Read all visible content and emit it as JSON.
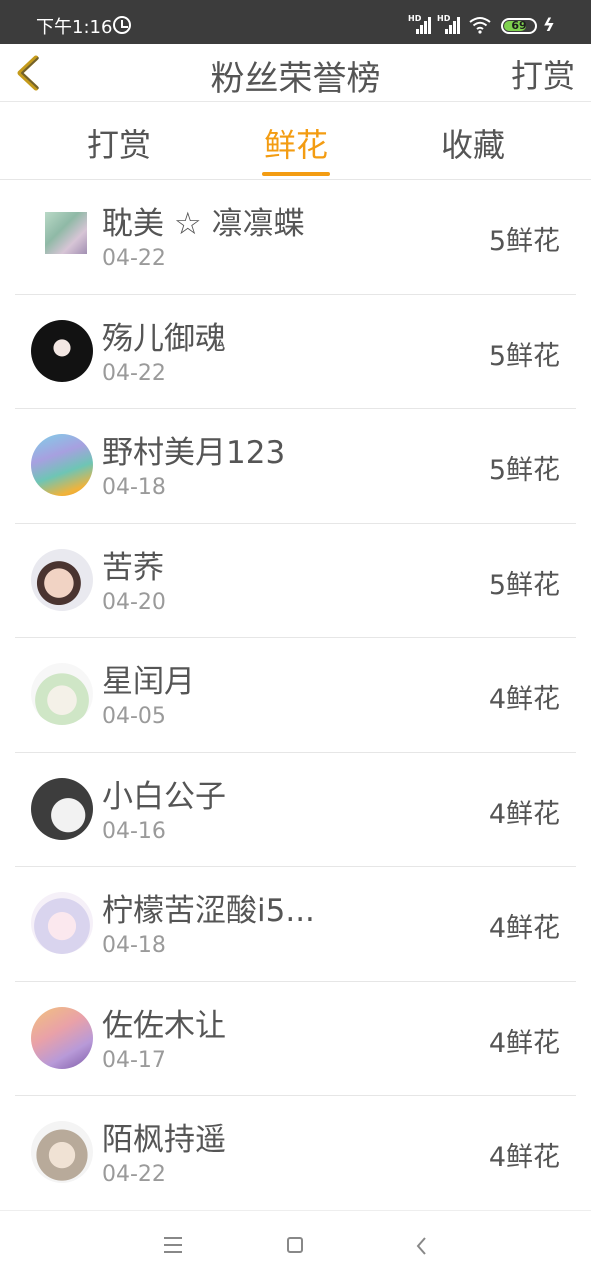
{
  "status_bar": {
    "time": "下午1:16",
    "signal_1_label": "HD",
    "signal_2_label": "HD",
    "battery": "69"
  },
  "header": {
    "title": "粉丝荣誉榜",
    "action_label": "打赏",
    "back_icon": "chevron-left-icon",
    "accent_color": "#f39c12"
  },
  "tabs": [
    {
      "label": "打赏",
      "active": false
    },
    {
      "label": "鲜花",
      "active": true
    },
    {
      "label": "收藏",
      "active": false
    }
  ],
  "fans": [
    {
      "name": "耽美 ☆ 凛凛蝶",
      "date": "04-22",
      "count": "5鲜花"
    },
    {
      "name": "殇儿御魂",
      "date": "04-22",
      "count": "5鲜花"
    },
    {
      "name": "野村美月123",
      "date": "04-18",
      "count": "5鲜花"
    },
    {
      "name": "苦荞",
      "date": "04-20",
      "count": "5鲜花"
    },
    {
      "name": "星闰月",
      "date": "04-05",
      "count": "4鲜花"
    },
    {
      "name": "小白公子",
      "date": "04-16",
      "count": "4鲜花"
    },
    {
      "name": "柠檬苦涩酸i5...",
      "date": "04-18",
      "count": "4鲜花"
    },
    {
      "name": "佐佐木让",
      "date": "04-17",
      "count": "4鲜花"
    },
    {
      "name": "陌枫持遥",
      "date": "04-22",
      "count": "4鲜花"
    }
  ]
}
